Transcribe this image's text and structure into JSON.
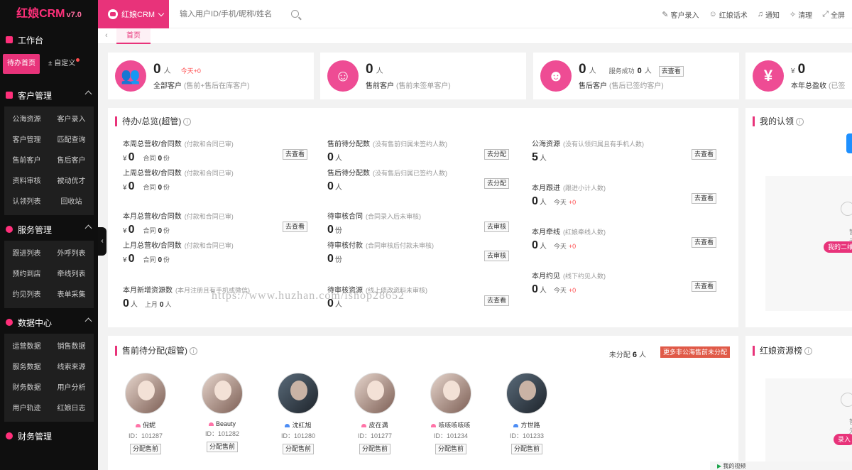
{
  "sidebar": {
    "logo": "红娘CRM",
    "version": "v7.0",
    "workspace": {
      "title": "工作台",
      "active": "待办首页",
      "custom": "± 自定义"
    },
    "sections": [
      {
        "title": "客户管理",
        "items": [
          "公海资源",
          "客户录入",
          "客户管理",
          "匹配查询",
          "售前客户",
          "售后客户",
          "资料审核",
          "被动优才",
          "认领列表",
          "回收站"
        ]
      },
      {
        "title": "服务管理",
        "items": [
          "跟进列表",
          "外呼列表",
          "预约到店",
          "牵线列表",
          "约见列表",
          "表单采集"
        ]
      },
      {
        "title": "数据中心",
        "items": [
          "运营数据",
          "销售数据",
          "服务数据",
          "线索来源",
          "财务数据",
          "用户分析",
          "用户轨迹",
          "红娘日志"
        ]
      },
      {
        "title": "财务管理",
        "items": []
      }
    ]
  },
  "topbar": {
    "brand": "红娘CRM",
    "search_placeholder": "输入用户ID/手机/昵称/姓名",
    "actions": [
      "客户录入",
      "红娘话术",
      "通知",
      "清理",
      "全屏"
    ]
  },
  "breadcrumb": {
    "tab": "首页"
  },
  "stats": [
    {
      "num": "0",
      "unit": "人",
      "today": "今天+0",
      "label": "全部客户",
      "note": "(售前+售后在库客户)",
      "icon": "users-icon"
    },
    {
      "num": "0",
      "unit": "人",
      "label": "售前客户",
      "note": "(售前未签单客户)",
      "icon": "headset-icon"
    },
    {
      "num": "0",
      "unit": "人",
      "extra_label": "服务成功",
      "extra_num": "0",
      "extra_unit": "人",
      "button": "去查看",
      "label": "售后客户",
      "note": "(售后已签约客户)",
      "icon": "face-icon"
    },
    {
      "num": "0",
      "yen": "¥",
      "label": "本年总盈收",
      "note": "(已签",
      "icon": "yen-icon"
    }
  ],
  "overview": {
    "title": "待办/总览(超管)",
    "col1": [
      {
        "title": "本周总营收/合同数",
        "note": "(付款和合同已审)",
        "yen": "¥",
        "value": "0",
        "sub_label": "合同",
        "sub_value": "0",
        "sub_unit": "份",
        "button": "去查看"
      },
      {
        "title": "上周总营收/合同数",
        "note": "(付款和合同已审)",
        "yen": "¥",
        "value": "0",
        "sub_label": "合同",
        "sub_value": "0",
        "sub_unit": "份"
      },
      {
        "title": "本月总营收/合同数",
        "note": "(付款和合同已审)",
        "yen": "¥",
        "value": "0",
        "sub_label": "合同",
        "sub_value": "0",
        "sub_unit": "份",
        "button": "去查看"
      },
      {
        "title": "上月总营收/合同数",
        "note": "(付款和合同已审)",
        "yen": "¥",
        "value": "0",
        "sub_label": "合同",
        "sub_value": "0",
        "sub_unit": "份"
      },
      {
        "title": "本月新增资源数",
        "note": "(本月注册且有手机或微信)",
        "value": "0",
        "unit": "人",
        "sub_label": "上月",
        "sub_value": "0",
        "sub_unit": "人"
      }
    ],
    "col2": [
      {
        "title": "售前待分配数",
        "note": "(没有售前归属未签约人数)",
        "value": "0",
        "unit": "人",
        "button": "去分配"
      },
      {
        "title": "售后待分配数",
        "note": "(没有售后归属已签约人数)",
        "value": "0",
        "unit": "人",
        "button": "去分配"
      },
      {
        "title": "待审核合同",
        "note": "(合同录入后未审核)",
        "value": "0",
        "unit": "份",
        "button": "去审核"
      },
      {
        "title": "待审核付款",
        "note": "(合同审核后付款未审核)",
        "value": "0",
        "unit": "份",
        "button": "去审核"
      },
      {
        "title": "待审核资源",
        "note": "(线上修改资料未审核)",
        "value": "0",
        "unit": "人",
        "button": "去查看"
      }
    ],
    "col3": [
      {
        "title": "公海资源",
        "note": "(没有认领归属且有手机人数)",
        "value": "5",
        "unit": "人",
        "button": "去查看"
      },
      {
        "title": "本月跟进",
        "note": "(跟进小计人数)",
        "value": "0",
        "unit": "人",
        "today": "今天",
        "today_val": "+0",
        "button": "去查看"
      },
      {
        "title": "本月牵线",
        "note": "(红娘牵线人数)",
        "value": "0",
        "unit": "人",
        "today": "今天",
        "today_val": "+0",
        "button": "去查看"
      },
      {
        "title": "本月约见",
        "note": "(线下约见人数)",
        "value": "0",
        "unit": "人",
        "today": "今天",
        "today_val": "+0",
        "button": "去查看"
      }
    ]
  },
  "presale": {
    "title": "售前待分配(超管)",
    "count_label": "未分配",
    "count": "6",
    "count_unit": "人",
    "more": "更多非公海售前未分配",
    "agents": [
      {
        "name": "倪妮",
        "id": "ID：101287",
        "gender": "f",
        "button": "分配售前"
      },
      {
        "name": "Beauty",
        "id": "ID：101282",
        "gender": "f",
        "button": "分配售前"
      },
      {
        "name": "沈红旭",
        "id": "ID：101280",
        "gender": "m",
        "button": "分配售前"
      },
      {
        "name": "皮在满",
        "id": "ID：101277",
        "gender": "f",
        "button": "分配售前"
      },
      {
        "name": "咳咳咳咳咳",
        "id": "ID：101234",
        "gender": "f",
        "button": "分配售前"
      },
      {
        "name": "方世路",
        "id": "ID：101233",
        "gender": "m",
        "button": "分配售前"
      }
    ]
  },
  "watermark": "https://www.huzhan.com/ishop28652",
  "my_claims": {
    "title": "我的认领",
    "empty": "暂无",
    "pill": "我的二维"
  },
  "ranking": {
    "title": "红娘资源榜",
    "empty": "暂无",
    "pill": "录入"
  },
  "bottombar": {
    "items": [
      "我的视频"
    ]
  },
  "colors": {
    "accent": "#e8337a",
    "sidebar": "#0f0f0f",
    "danger": "#ff4d4f",
    "orange_btn": "#e05a48"
  }
}
